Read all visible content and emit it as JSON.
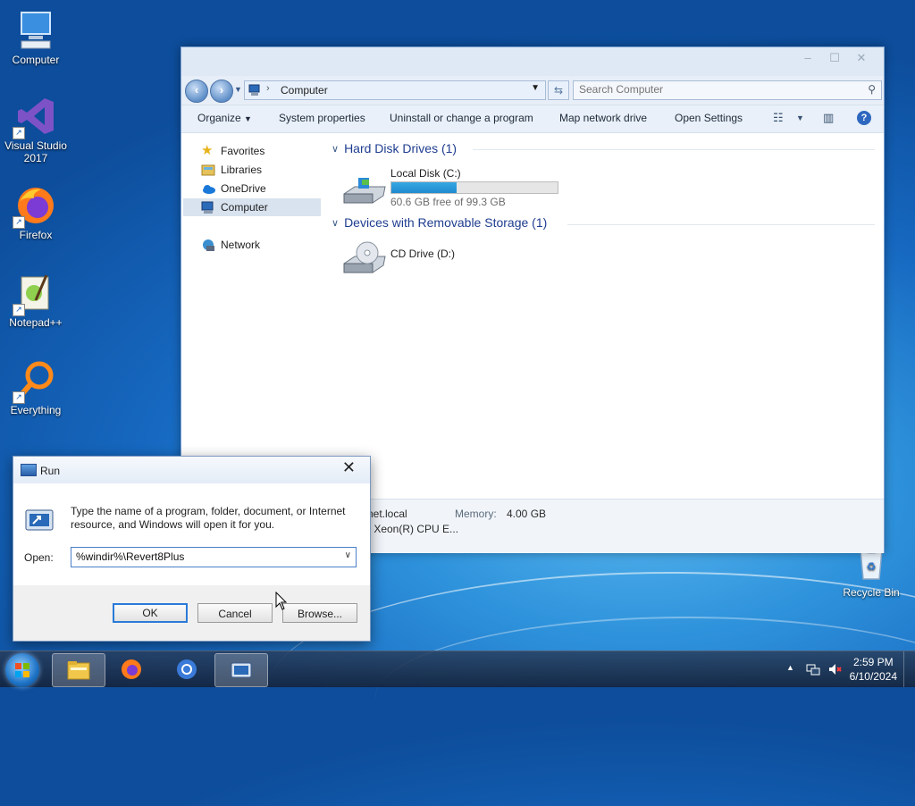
{
  "desktop": {
    "icons": [
      {
        "label": "Computer"
      },
      {
        "label": "Visual Studio 2017"
      },
      {
        "label": "Firefox"
      },
      {
        "label": "Notepad++"
      },
      {
        "label": "Everything"
      },
      {
        "label": "Recycle Bin"
      }
    ]
  },
  "explorer": {
    "address": {
      "crumb": "Computer"
    },
    "search_placeholder": "Search Computer",
    "commands": {
      "organize": "Organize",
      "system_properties": "System properties",
      "uninstall": "Uninstall or change a program",
      "map_drive": "Map network drive",
      "open_settings": "Open Settings"
    },
    "nav": {
      "favorites": "Favorites",
      "libraries": "Libraries",
      "onedrive": "OneDrive",
      "computer": "Computer",
      "network": "Network"
    },
    "groups": {
      "hdd": "Hard Disk Drives (1)",
      "removable": "Devices with Removable Storage (1)"
    },
    "drives": {
      "c": {
        "name": "Local Disk (C:)",
        "free_text": "60.6 GB free of 99.3 GB",
        "used_fraction": 0.39
      },
      "d": {
        "name": "CD Drive (D:)"
      }
    },
    "details": {
      "domain_partial": "net.local",
      "memory_label": "Memory:",
      "memory_value": "4.00 GB",
      "cpu_partial": ") Xeon(R) CPU E..."
    }
  },
  "run_dialog": {
    "title": "Run",
    "description": "Type the name of a program, folder, document, or Internet resource, and Windows will open it for you.",
    "open_label": "Open:",
    "open_value": "%windir%\\Revert8Plus",
    "ok": "OK",
    "cancel": "Cancel",
    "browse": "Browse..."
  },
  "taskbar": {
    "time": "2:59 PM",
    "date": "6/10/2024"
  }
}
